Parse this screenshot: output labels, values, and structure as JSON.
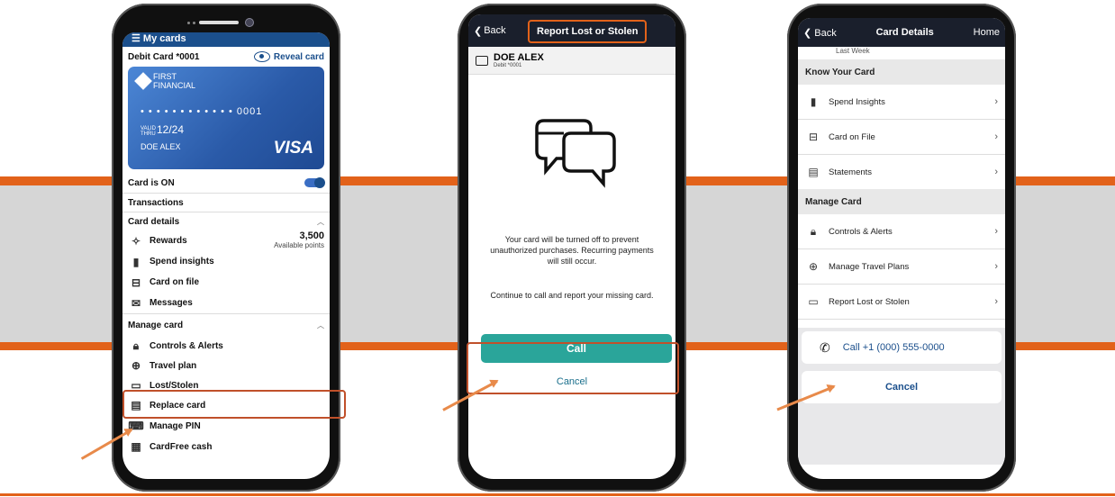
{
  "colors": {
    "accent_orange": "#e2621a",
    "brand_blue": "#1b4f8c",
    "call_teal": "#2aa59a",
    "nav_dark": "#1a1f2c"
  },
  "phone1": {
    "header": "My cards",
    "card_label": "Debit Card *0001",
    "reveal": "Reveal card",
    "card": {
      "bank_line1": "FIRST",
      "bank_line2": "FINANCIAL",
      "number": "• • • •  • • • •  • • • •  0001",
      "valid_label1": "VALID",
      "valid_label2": "THRU",
      "expiry": "12/24",
      "holder": "DOE ALEX",
      "network": "VISA"
    },
    "card_status": "Card is ON",
    "transactions": "Transactions",
    "card_details": "Card details",
    "rewards": "Rewards",
    "points_value": "3,500",
    "points_label": "Available points",
    "spend_insights": "Spend insights",
    "card_on_file": "Card on file",
    "messages": "Messages",
    "manage_card": "Manage card",
    "controls_alerts": "Controls & Alerts",
    "travel_plan": "Travel plan",
    "lost_stolen": "Lost/Stolen",
    "replace_card": "Replace card",
    "manage_pin": "Manage PIN",
    "cardfree": "CardFree cash"
  },
  "phone2": {
    "back": "Back",
    "title": "Report Lost or Stolen",
    "user_name": "DOE ALEX",
    "user_card": "Debit *0001",
    "message1": "Your card will be turned off to prevent unauthorized purchases. Recurring payments will still occur.",
    "message2": "Continue to call and report your missing card.",
    "call": "Call",
    "cancel": "Cancel"
  },
  "phone3": {
    "back": "Back",
    "title": "Card Details",
    "home": "Home",
    "last_week": "Last Week",
    "know_card": "Know Your Card",
    "spend_insights": "Spend Insights",
    "card_on_file": "Card on File",
    "statements": "Statements",
    "manage_card": "Manage Card",
    "controls_alerts": "Controls & Alerts",
    "travel_plans": "Manage Travel Plans",
    "report_lost": "Report Lost or Stolen",
    "call_number": "Call +1 (000) 555-0000",
    "cancel": "Cancel"
  }
}
